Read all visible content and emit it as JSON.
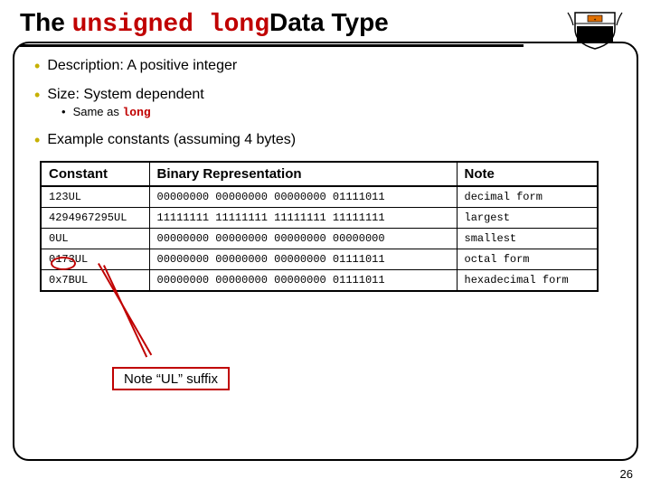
{
  "title": {
    "pre": "The ",
    "kw": "unsigned long",
    "post": "Data Type"
  },
  "bullets": {
    "desc": "Description:  A positive integer",
    "size": "Size:  System dependent",
    "size_sub_pre": "Same as ",
    "size_sub_kw": "long",
    "example": "Example constants (assuming 4 bytes)"
  },
  "table": {
    "headers": {
      "c1": "Constant",
      "c2": "Binary Representation",
      "c3": "Note"
    },
    "rows": [
      {
        "c1": "123UL",
        "c2": "00000000 00000000 00000000 01111011",
        "c3": "decimal form"
      },
      {
        "c1": "4294967295UL",
        "c2": "11111111 11111111 11111111 11111111",
        "c3": "largest"
      },
      {
        "c1": "0UL",
        "c2": "00000000 00000000 00000000 00000000",
        "c3": "smallest"
      },
      {
        "c1": "0173UL",
        "c2": "00000000 00000000 00000000 01111011",
        "c3": "octal form"
      },
      {
        "c1": "0x7BUL",
        "c2": "00000000 00000000 00000000 01111011",
        "c3": "hexadecimal form"
      }
    ]
  },
  "callout": "Note “UL” suffix",
  "pagenum": "26"
}
